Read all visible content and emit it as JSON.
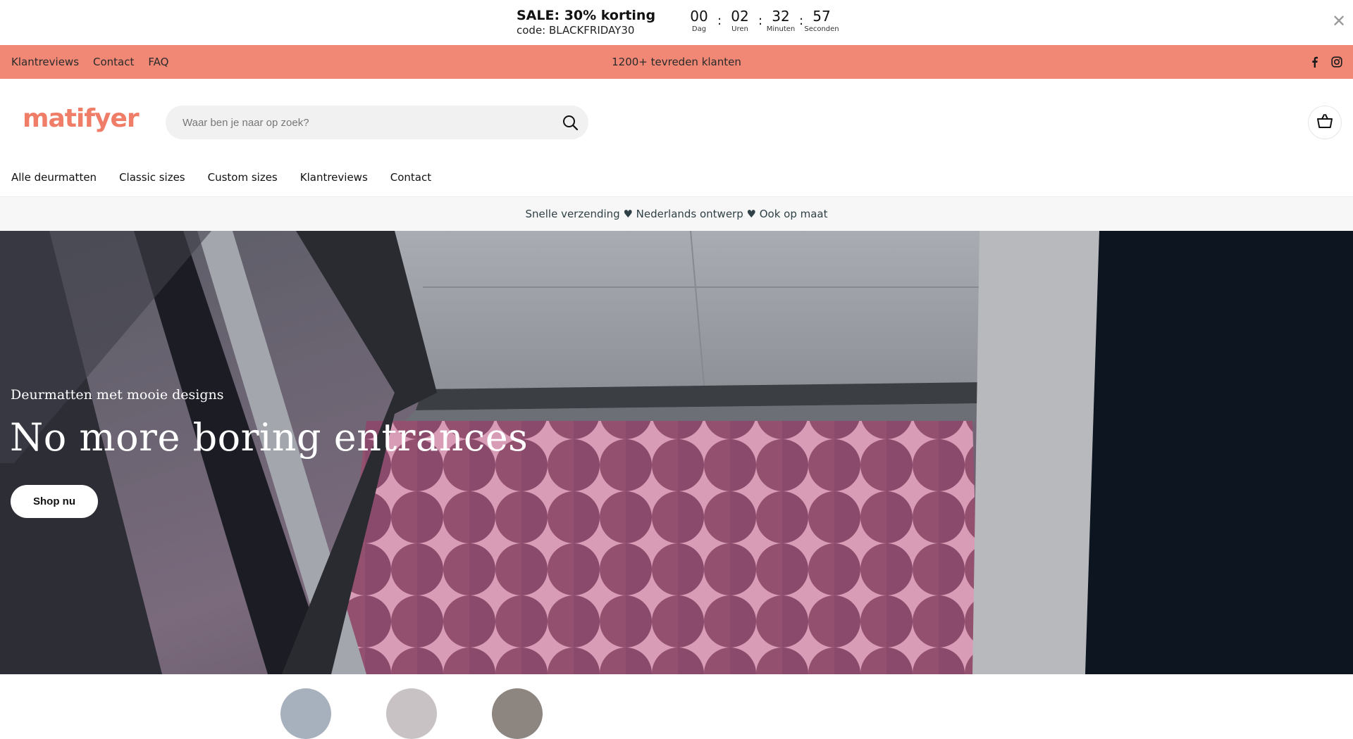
{
  "sale": {
    "title": "SALE: 30% korting",
    "code": "code: BLACKFRIDAY30",
    "countdown": [
      {
        "value": "00",
        "label": "Dag"
      },
      {
        "value": "02",
        "label": "Uren"
      },
      {
        "value": "32",
        "label": "Minuten"
      },
      {
        "value": "57",
        "label": "Seconden"
      }
    ],
    "separator": ":",
    "close_glyph": "✕"
  },
  "top_bar": {
    "links": [
      "Klantreviews",
      "Contact",
      "FAQ"
    ],
    "center_text": "1200+ tevreden klanten",
    "socials": [
      "facebook-icon",
      "instagram-icon"
    ],
    "color": "#f08875"
  },
  "header": {
    "logo": "matifyer",
    "logo_color": "#ef7d68",
    "search_placeholder": "Waar ben je naar op zoek?",
    "search_icon": "search-icon",
    "cart_icon": "cart-icon"
  },
  "nav": {
    "items": [
      "Alle deurmatten",
      "Classic sizes",
      "Custom sizes",
      "Klantreviews",
      "Contact"
    ]
  },
  "usp": {
    "text": "Snelle verzending ♥ Nederlands ontwerp ♥ Ook op maat"
  },
  "hero": {
    "subtitle": "Deurmatten met mooie designs",
    "title": "No more boring entrances",
    "button": "Shop nu"
  }
}
